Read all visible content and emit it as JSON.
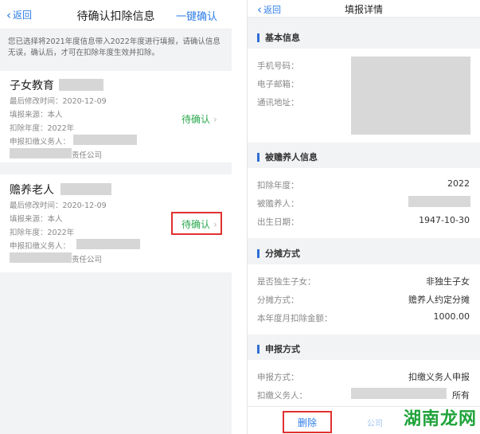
{
  "left": {
    "nav": {
      "back_label": "返回",
      "title": "待确认扣除信息",
      "action_label": "一键确认"
    },
    "notice": "您已选择将2021年度信息带入2022年度进行填报，请确认信息无误，确认后，才可在扣除年度生效并扣除。",
    "cards": [
      {
        "title": "子女教育",
        "modified": "最后修改时间：2020-12-09",
        "source": "填报来源：本人",
        "year": "扣除年度：2022年",
        "withholder": "申报扣缴义务人：",
        "company_suffix": "责任公司",
        "status": "待确认"
      },
      {
        "title": "赡养老人",
        "modified": "最后修改时间：2020-12-09",
        "source": "填报来源：本人",
        "year": "扣除年度：2022年",
        "withholder": "申报扣缴义务人：",
        "company_suffix": "责任公司",
        "status": "待确认"
      }
    ]
  },
  "right": {
    "nav": {
      "back_label": "返回",
      "title": "填报详情"
    },
    "sections": {
      "basic": {
        "title": "基本信息",
        "phone_label": "手机号码：",
        "email_label": "电子邮箱：",
        "address_label": "通讯地址："
      },
      "dependent": {
        "title": "被赡养人信息",
        "year_label": "扣除年度：",
        "year_value": "2022",
        "person_label": "被赡养人：",
        "birth_label": "出生日期：",
        "birth_value": "1947-10-30"
      },
      "split": {
        "title": "分摊方式",
        "only_child_label": "是否独生子女：",
        "only_child_value": "非独生子女",
        "method_label": "分摊方式：",
        "method_value": "赡养人约定分摊",
        "amount_label": "本年度月扣除金额：",
        "amount_value": "1000.00"
      },
      "declare": {
        "title": "申报方式",
        "mode_label": "申报方式：",
        "mode_value": "扣缴义务人申报",
        "withholder_label": "扣缴义务人：",
        "withholder_suffix": "所有"
      }
    },
    "delete_label": "删除",
    "partial_hint": "公司"
  },
  "watermark": "湖南龙网",
  "colors": {
    "link_blue": "#2d7de6",
    "status_green": "#2aa84e",
    "highlight_red": "#e03131",
    "section_bar": "#2d6fd6"
  }
}
